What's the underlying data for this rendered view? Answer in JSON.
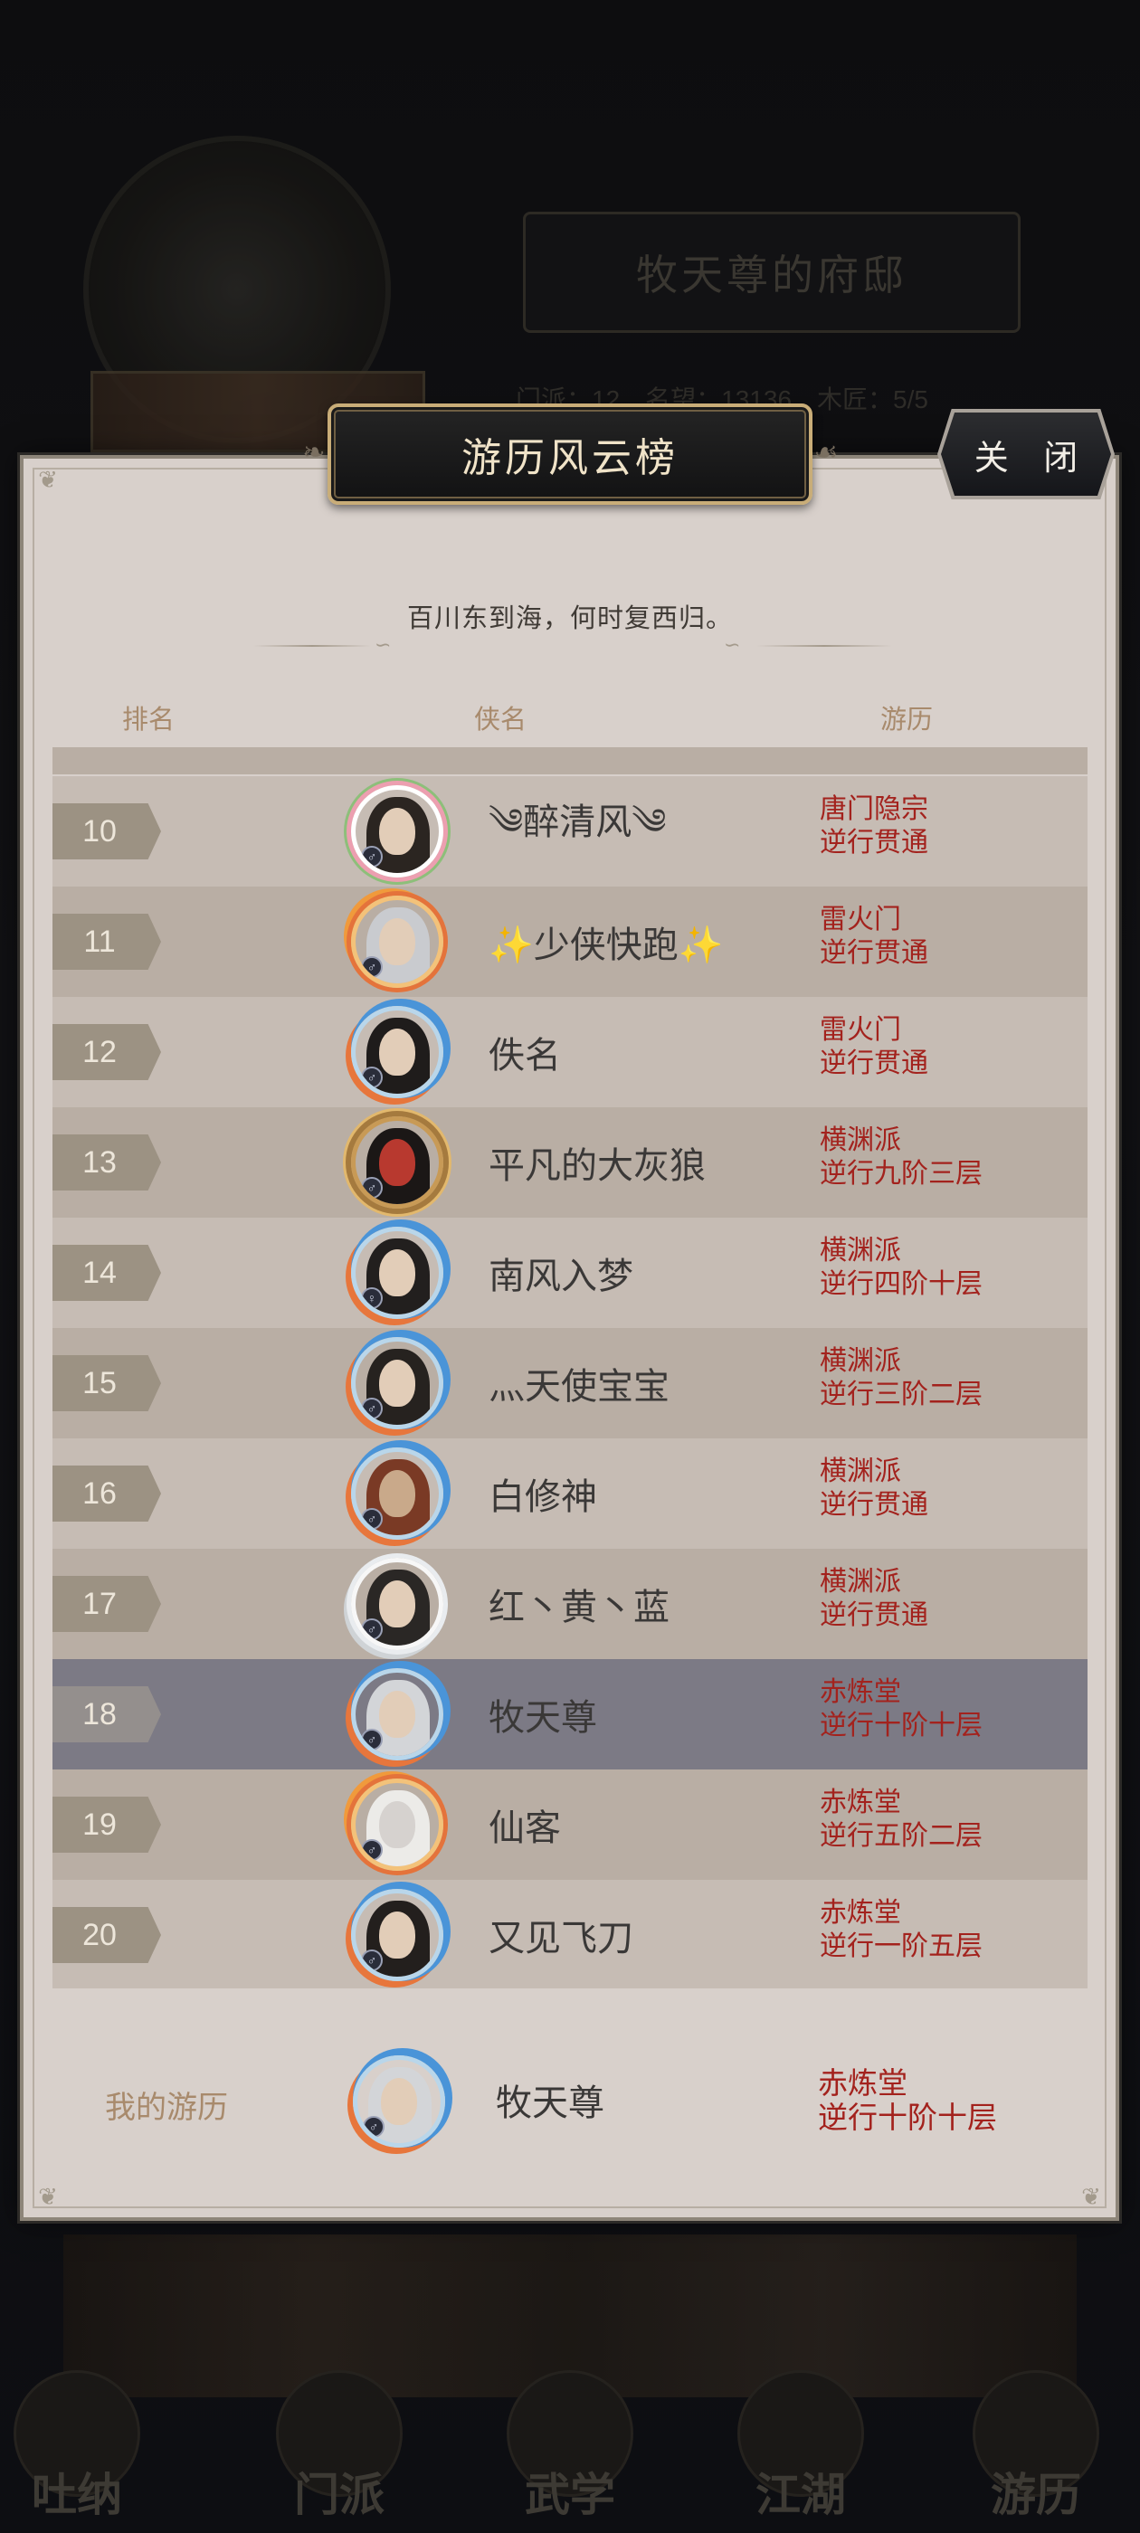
{
  "background": {
    "mansion_title": "牧天尊的府邸",
    "stats": [
      "门派：12",
      "名望：13136",
      "木匠：5/5"
    ],
    "nav": [
      "吐纳",
      "门派",
      "武学",
      "江湖",
      "游历"
    ]
  },
  "modal": {
    "title": "游历风云榜",
    "close_label": "关 闭",
    "subtitle": "百川东到海，何时复西归。",
    "columns": {
      "rank": "排名",
      "name": "侠名",
      "progress": "游历"
    }
  },
  "rows": [
    {
      "rank": "10",
      "name": "༄醉清风༄",
      "sect": "唐门隐宗",
      "progress": "逆行贯通",
      "frame": "flower"
    },
    {
      "rank": "11",
      "name": "✨少侠快跑✨",
      "sect": "雷火门",
      "progress": "逆行贯通",
      "frame": "flame"
    },
    {
      "rank": "12",
      "name": "佚名",
      "sect": "雷火门",
      "progress": "逆行贯通",
      "frame": "water"
    },
    {
      "rank": "13",
      "name": "平凡的大灰狼",
      "sect": "横渊派",
      "progress": "逆行九阶三层",
      "frame": "gold"
    },
    {
      "rank": "14",
      "name": "南风入梦",
      "sect": "横渊派",
      "progress": "逆行四阶十层",
      "frame": "water"
    },
    {
      "rank": "15",
      "name": "灬天使宝宝",
      "sect": "横渊派",
      "progress": "逆行三阶二层",
      "frame": "water"
    },
    {
      "rank": "16",
      "name": "白修神",
      "sect": "横渊派",
      "progress": "逆行贯通",
      "frame": "water"
    },
    {
      "rank": "17",
      "name": "红丶黄丶蓝",
      "sect": "横渊派",
      "progress": "逆行贯通",
      "frame": "cloud"
    },
    {
      "rank": "18",
      "name": "牧天尊",
      "sect": "赤炼堂",
      "progress": "逆行十阶十层",
      "frame": "water",
      "is_me": true
    },
    {
      "rank": "19",
      "name": "仙客",
      "sect": "赤炼堂",
      "progress": "逆行五阶二层",
      "frame": "flame"
    },
    {
      "rank": "20",
      "name": "又见飞刀",
      "sect": "赤炼堂",
      "progress": "逆行一阶五层",
      "frame": "water"
    }
  ],
  "my_record": {
    "label": "我的游历",
    "name": "牧天尊",
    "sect": "赤炼堂",
    "progress": "逆行十阶十层"
  },
  "colors": {
    "panel": "#d8d0cb",
    "row_odd": "#c6bcb4",
    "row_even": "#b9aea4",
    "row_highlight": "#7c7a85",
    "sect_text": "#a3221d",
    "header_text": "#a88a6c"
  }
}
